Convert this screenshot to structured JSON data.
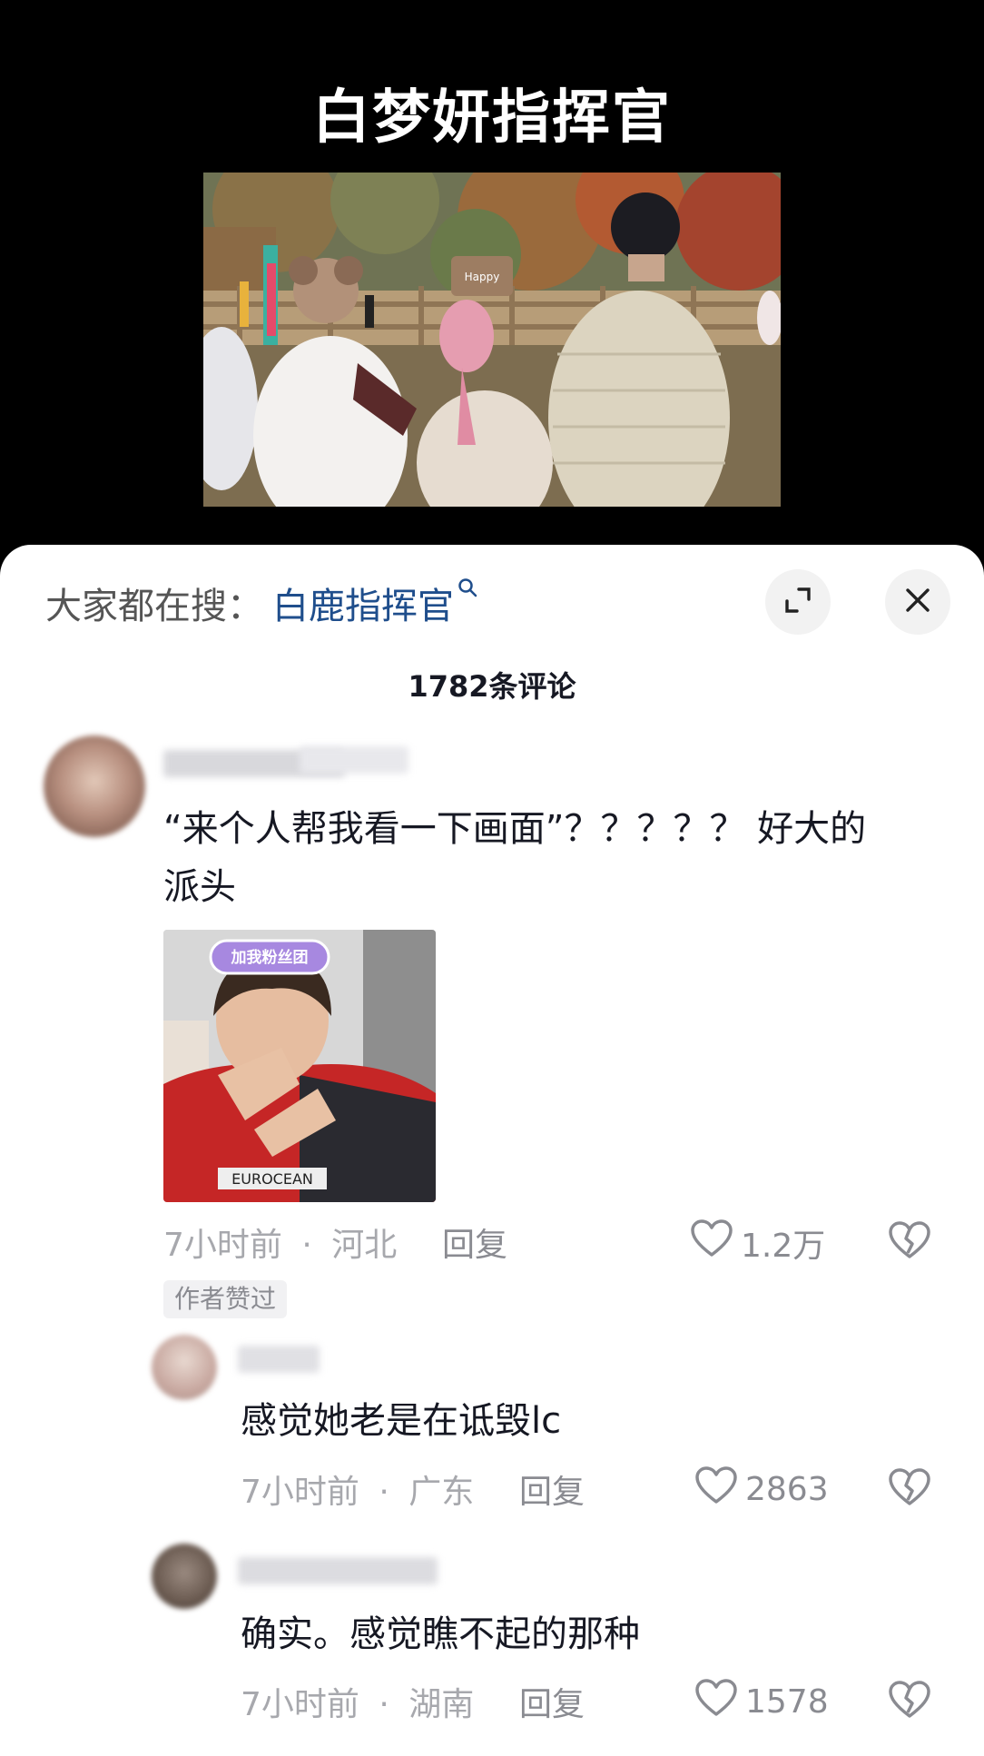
{
  "video": {
    "title": "白梦妍指挥官",
    "subtitle_peek": "来个人帮我看一下画面",
    "sign_text": "Happy"
  },
  "comments_panel": {
    "search_prefix": "大家都在搜：",
    "search_term": "白鹿指挥官",
    "count_label": "1782条评论",
    "icons": {
      "search": "search-icon",
      "expand": "expand-icon",
      "close": "close-icon",
      "like": "heart-icon",
      "dislike": "broken-heart-icon"
    }
  },
  "comments": [
    {
      "text_line1": "“来个人帮我看一下画面”？？？？？ 好大的",
      "text_line2": "派头",
      "time": "7小时前",
      "separator": "·",
      "location": "河北",
      "reply_label": "回复",
      "likes": "1.2万",
      "badge": "作者赞过",
      "sticker_text": "加我粉丝团",
      "sticker_shirt_text": "EUROCEAN"
    },
    {
      "text": "感觉她老是在诋毁lc",
      "time": "7小时前",
      "separator": "·",
      "location": "广东",
      "reply_label": "回复",
      "likes": "2863"
    },
    {
      "text": "确实。感觉瞧不起的那种",
      "time": "7小时前",
      "separator": "·",
      "location": "湖南",
      "reply_label": "回复",
      "likes": "1578"
    }
  ],
  "colors": {
    "accent_link": "#1f4e8c",
    "meta_gray": "#a7a8ad",
    "sheet_bg": "#ffffff",
    "video_bg": "#000000"
  }
}
